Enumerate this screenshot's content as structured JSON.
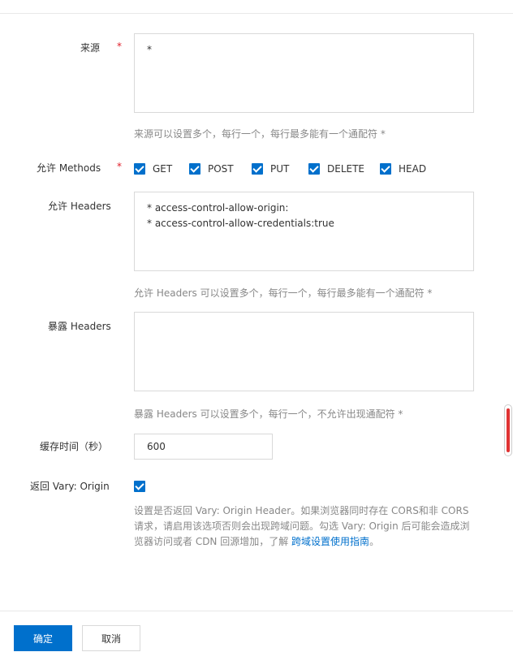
{
  "form": {
    "origin": {
      "label": "来源",
      "required_mark": "*",
      "value_lines": [
        "*"
      ],
      "hint": "来源可以设置多个，每行一个，每行最多能有一个通配符 *"
    },
    "methods": {
      "label": "允许 Methods",
      "required_mark": "*",
      "options": [
        {
          "label": "GET",
          "checked": true
        },
        {
          "label": "POST",
          "checked": true
        },
        {
          "label": "PUT",
          "checked": true
        },
        {
          "label": "DELETE",
          "checked": true
        },
        {
          "label": "HEAD",
          "checked": true
        }
      ]
    },
    "allow_headers": {
      "label": "允许 Headers",
      "value_lines": [
        "* access-control-allow-origin:",
        "* access-control-allow-credentials:true"
      ],
      "hint": "允许 Headers 可以设置多个，每行一个，每行最多能有一个通配符 *"
    },
    "expose_headers": {
      "label": "暴露 Headers",
      "value_lines": [],
      "hint": "暴露 Headers 可以设置多个，每行一个，不允许出现通配符 *"
    },
    "cache_time": {
      "label": "缓存时间（秒）",
      "value": "600"
    },
    "vary": {
      "label": "返回 Vary: Origin",
      "checked": true,
      "description_lines": [
        "设置是否返回 Vary: Origin Header。如果浏览器同时存在 CORS和非 CORS",
        "请求，请启用该选项否则会出现跨域问题。勾选 Vary: Origin 后可能会造成浏",
        "览器访问或者 CDN 回源增加，了解 "
      ],
      "link_text": "跨域设置使用指南",
      "after_link": "。"
    }
  },
  "footer": {
    "confirm_label": "确定",
    "cancel_label": "取消"
  },
  "colors": {
    "primary": "#0070cc",
    "required": "#e0202b",
    "hint": "#888888",
    "scroll_thumb": "#e03333"
  }
}
